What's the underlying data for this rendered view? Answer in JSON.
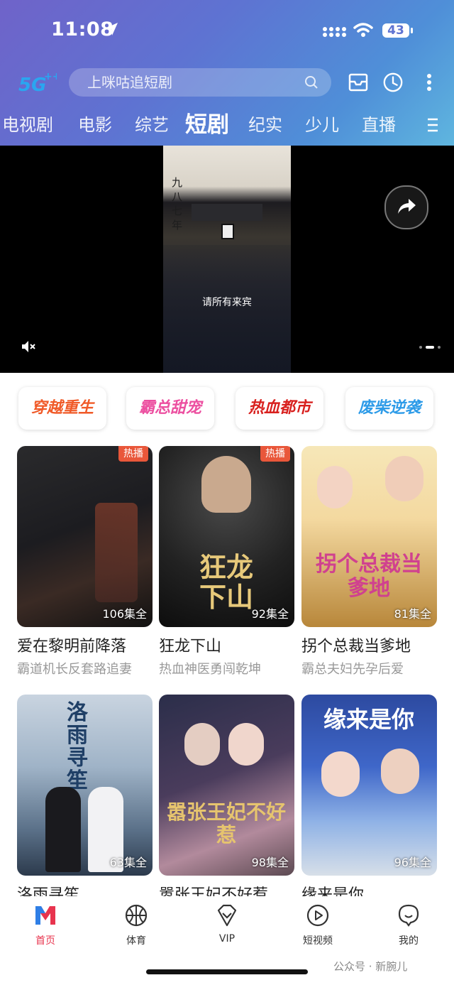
{
  "status_bar": {
    "time": "11:08",
    "battery": "43"
  },
  "header": {
    "logo": "5G",
    "search_placeholder": "上咪咕追短剧"
  },
  "categories": [
    "电视剧",
    "电影",
    "综艺",
    "短剧",
    "纪实",
    "少儿",
    "直播"
  ],
  "active_category": "短剧",
  "video": {
    "subtitle": "请所有来宾",
    "vertical_text": "九八七年"
  },
  "genre_chips": [
    {
      "label": "穿越重生",
      "color": "#f05a28"
    },
    {
      "label": "霸总甜宠",
      "color": "#ec4fa0"
    },
    {
      "label": "热血都市",
      "color": "#d8201e"
    },
    {
      "label": "废柴逆袭",
      "color": "#2d9be8"
    }
  ],
  "dramas": [
    {
      "badge": "热播",
      "episodes": "106集全",
      "title": "爱在黎明前降落",
      "subtitle": "霸道机长反套路追妻",
      "poster_text": ""
    },
    {
      "badge": "热播",
      "episodes": "92集全",
      "title": "狂龙下山",
      "subtitle": "热血神医勇闯乾坤",
      "poster_text": "狂龙下山"
    },
    {
      "badge": "",
      "episodes": "81集全",
      "title": "拐个总裁当爹地",
      "subtitle": "霸总夫妇先孕后爱",
      "poster_text": "拐个总裁当爹地"
    },
    {
      "badge": "",
      "episodes": "63集全",
      "title": "洛雨寻笙",
      "subtitle": "",
      "poster_text": "洛雨寻笙"
    },
    {
      "badge": "",
      "episodes": "98集全",
      "title": "嚣张王妃不好惹",
      "subtitle": "",
      "poster_text": "嚣张王妃不好惹"
    },
    {
      "badge": "",
      "episodes": "96集全",
      "title": "缘来是你",
      "subtitle": "",
      "poster_text": "缘来是你"
    }
  ],
  "tabbar": {
    "home": "首页",
    "sports": "体育",
    "vip": "VIP",
    "short_video": "短视频",
    "mine": "我的"
  },
  "watermark": "公众号 · 新腕儿",
  "colors": {
    "accent": "#e8344e",
    "badge": "#e9573a"
  }
}
